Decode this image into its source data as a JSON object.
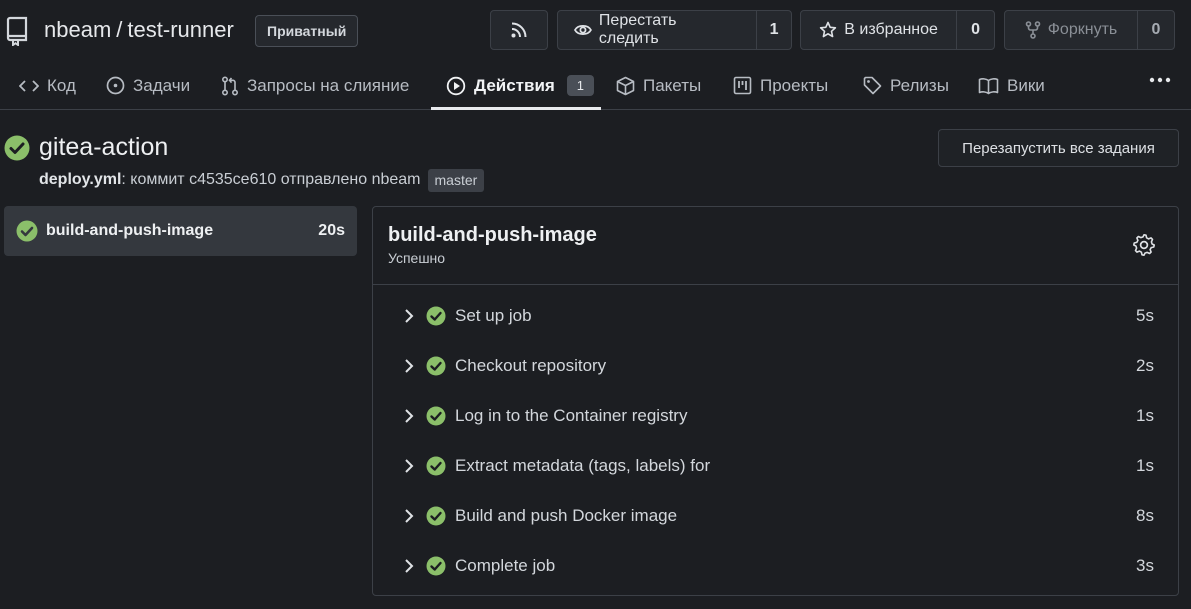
{
  "repo": {
    "owner": "nbeam",
    "separator": "/",
    "name": "test-runner",
    "visibility": "Приватный"
  },
  "header_buttons": {
    "watch_label": "Перестать следить",
    "watch_count": "1",
    "star_label": "В избранное",
    "star_count": "0",
    "fork_label": "Форкнуть",
    "fork_count": "0"
  },
  "tabs": [
    {
      "label": "Код",
      "icon": "code-icon"
    },
    {
      "label": "Задачи",
      "icon": "issue-icon"
    },
    {
      "label": "Запросы на слияние",
      "icon": "pull-request-icon"
    },
    {
      "label": "Действия",
      "icon": "play-icon",
      "badge": "1",
      "active": true
    },
    {
      "label": "Пакеты",
      "icon": "package-icon"
    },
    {
      "label": "Проекты",
      "icon": "project-icon"
    },
    {
      "label": "Релизы",
      "icon": "tag-icon"
    },
    {
      "label": "Вики",
      "icon": "book-icon"
    }
  ],
  "run": {
    "title": "gitea-action",
    "workflow": "deploy.yml",
    "meta_text": ": коммит c4535ce610 отправлено nbeam",
    "branch": "master",
    "rerun_label": "Перезапустить все задания"
  },
  "jobs": [
    {
      "name": "build-and-push-image",
      "duration": "20s",
      "status": "success"
    }
  ],
  "job_detail": {
    "title": "build-and-push-image",
    "status_text": "Успешно",
    "steps": [
      {
        "name": "Set up job",
        "duration": "5s"
      },
      {
        "name": "Checkout repository",
        "duration": "2s"
      },
      {
        "name": "Log in to the Container registry",
        "duration": "1s"
      },
      {
        "name": "Extract metadata (tags, labels) for",
        "duration": "1s"
      },
      {
        "name": "Build and push Docker image",
        "duration": "8s"
      },
      {
        "name": "Complete job",
        "duration": "3s"
      }
    ]
  },
  "colors": {
    "background": "#1c1e22",
    "success": "#8bbf6a",
    "border": "#3c4047",
    "selected_job": "#34383e"
  }
}
